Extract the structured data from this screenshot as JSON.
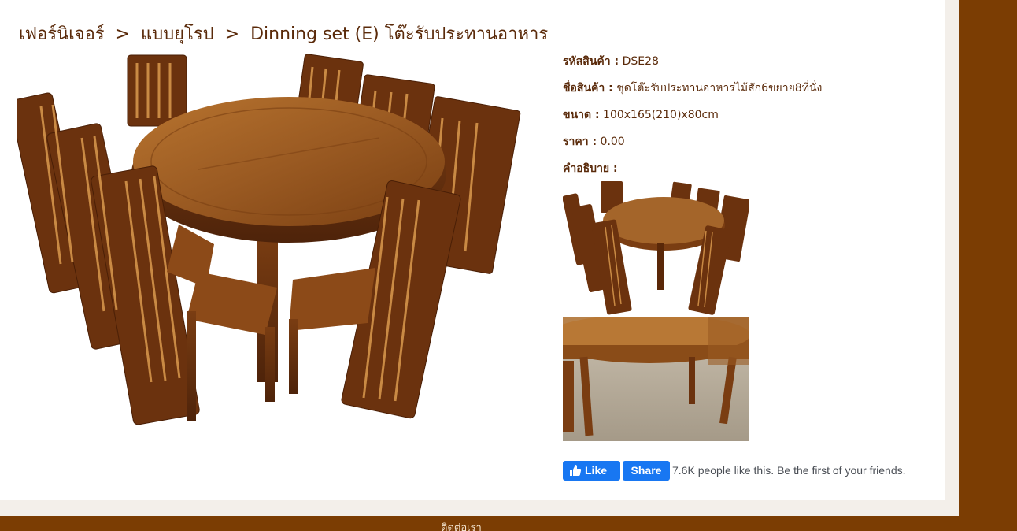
{
  "breadcrumb": {
    "items": [
      "เฟอร์นิเจอร์",
      "แบบยุโรป",
      "Dinning set (E) โต๊ะรับประทานอาหาร"
    ],
    "separator": ">"
  },
  "product": {
    "code_label": "รหัสสินค้า :",
    "code": "DSE28",
    "name_label": "ชื่อสินค้า :",
    "name": "ชุดโต๊ะรับประทานอาหารไม้สัก6ขยาย8ที่นั่ง",
    "size_label": "ขนาด :",
    "size": "100x165(210)x80cm",
    "price_label": "ราคา :",
    "price": "0.00",
    "desc_label": "คำอธิบาย :"
  },
  "facebook": {
    "like_label": "Like",
    "share_label": "Share",
    "count_text": "7.6K people like this. Be the first of your friends."
  },
  "footer": {
    "text": "ติดต่อเรา"
  },
  "colors": {
    "brand_brown": "#7b3d03",
    "text_brown": "#5a2a0a",
    "facebook_blue": "#1877f2"
  }
}
